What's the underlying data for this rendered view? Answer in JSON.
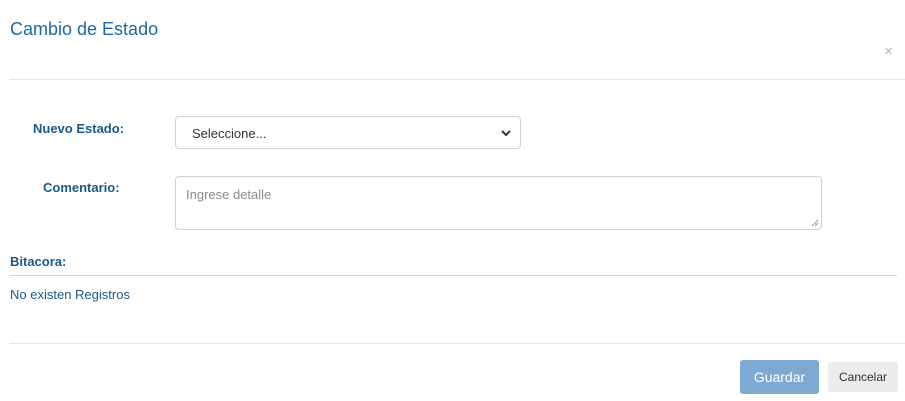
{
  "modal": {
    "title": "Cambio de Estado",
    "close_label": "×"
  },
  "form": {
    "estado_label": "Nuevo Estado:",
    "estado_selected": "Seleccione...",
    "comentario_label": "Comentario:",
    "comentario_placeholder": "Ingrese detalle",
    "comentario_value": ""
  },
  "bitacora": {
    "title": "Bitacora:",
    "empty_text": "No existen Registros"
  },
  "footer": {
    "save_label": "Guardar",
    "cancel_label": "Cancelar"
  },
  "colors": {
    "accent": "#1a6aa5",
    "save_button": "#7ea9d3"
  },
  "icons": {
    "select_arrow": "chevron-down-icon",
    "close": "close-icon"
  }
}
